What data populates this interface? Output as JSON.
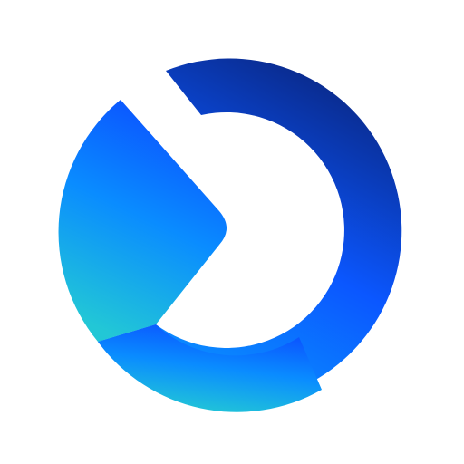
{
  "logo": {
    "icon": "app-logo-icon",
    "shape": "circular ring with play-arrow cutout",
    "colors": {
      "background": "#ffffff",
      "navy": "#0a2a8c",
      "royal_blue": "#0b57ff",
      "bright_blue": "#0a8cff",
      "teal": "#22c7d6"
    }
  }
}
